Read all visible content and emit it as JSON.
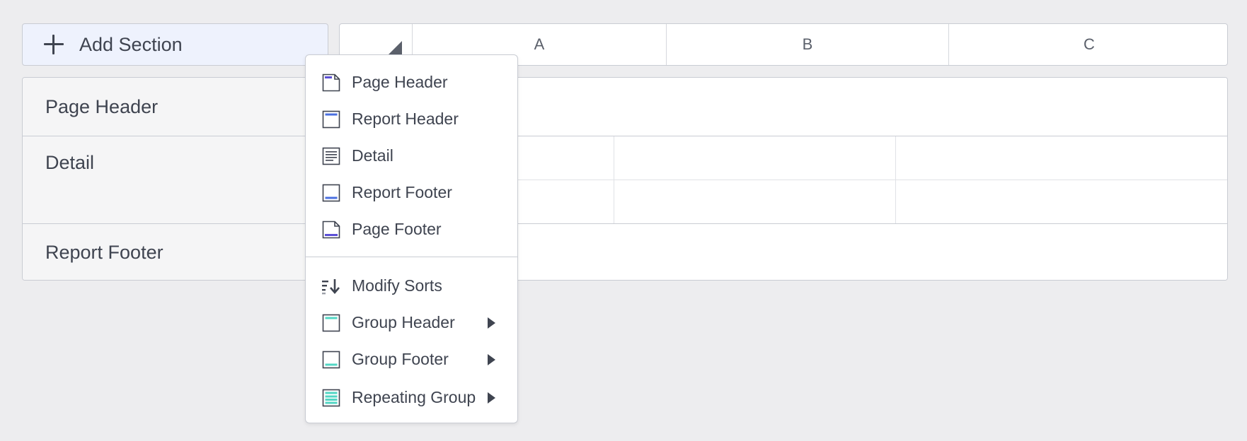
{
  "toolbar": {
    "add_section_label": "Add Section"
  },
  "columns": [
    "A",
    "B",
    "C"
  ],
  "sections": [
    {
      "label": "Page Header"
    },
    {
      "label": "Detail"
    },
    {
      "label": "Report Footer"
    }
  ],
  "menu": {
    "items": [
      {
        "label": "Page Header",
        "icon": "page-header-icon",
        "submenu": false
      },
      {
        "label": "Report Header",
        "icon": "report-header-icon",
        "submenu": false
      },
      {
        "label": "Detail",
        "icon": "detail-icon",
        "submenu": false
      },
      {
        "label": "Report Footer",
        "icon": "report-footer-icon",
        "submenu": false
      },
      {
        "label": "Page Footer",
        "icon": "page-footer-icon",
        "submenu": false
      },
      {
        "label": "Modify Sorts",
        "icon": "sort-icon",
        "submenu": false
      },
      {
        "label": "Group Header",
        "icon": "group-header-icon",
        "submenu": true
      },
      {
        "label": "Group Footer",
        "icon": "group-footer-icon",
        "submenu": true
      },
      {
        "label": "Repeating Group",
        "icon": "repeating-group-icon",
        "submenu": true
      }
    ]
  },
  "colors": {
    "accent_purple": "#5b4fd6",
    "accent_blue": "#4a6fe0",
    "accent_teal": "#52d6c4",
    "text": "#3f4450",
    "button_bg": "#eef2fd"
  }
}
